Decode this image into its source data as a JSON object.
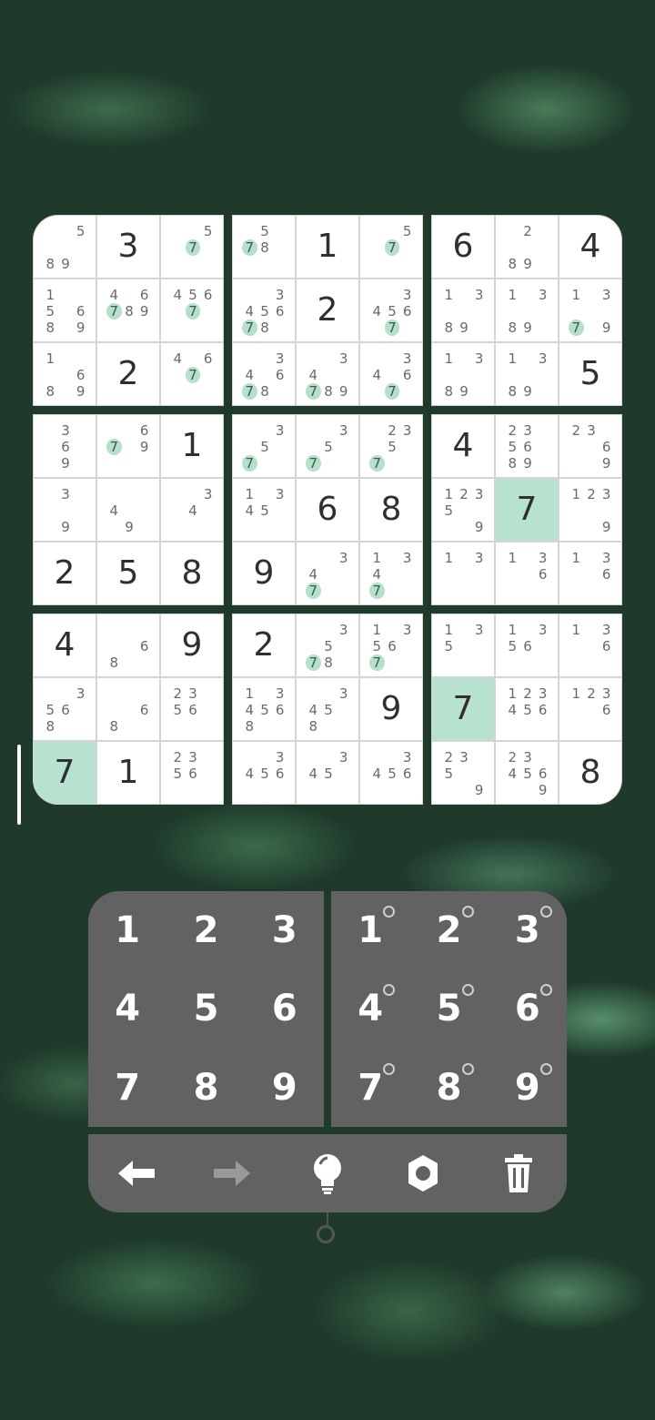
{
  "board": {
    "blocks": [
      [
        {
          "notes": [
            "",
            "",
            "5",
            "",
            "",
            "",
            "8",
            "9",
            ""
          ]
        },
        {
          "value": "3"
        },
        {
          "notes": [
            "",
            "",
            "5",
            "",
            "7",
            "",
            "",
            "",
            ""
          ],
          "hl": "7"
        },
        {
          "notes": [
            "1",
            "",
            "",
            "5",
            "",
            "6",
            "8",
            "",
            "9"
          ]
        },
        {
          "notes": [
            "4",
            "",
            "6",
            "7",
            "8",
            "9",
            "",
            "",
            ""
          ],
          "hl": "7"
        },
        {
          "notes": [
            "4",
            "5",
            "6",
            "",
            "7",
            "",
            "",
            "",
            ""
          ],
          "hl": "7"
        },
        {
          "notes": [
            "1",
            "",
            "",
            "",
            "",
            "6",
            "8",
            "",
            "9"
          ]
        },
        {
          "value": "2"
        },
        {
          "notes": [
            "4",
            "",
            "6",
            "",
            "7",
            "",
            "",
            "",
            ""
          ],
          "hl": "7"
        }
      ],
      [
        {
          "notes": [
            "",
            "5",
            "",
            "7",
            "8",
            "",
            "",
            "",
            ""
          ],
          "hl": "7"
        },
        {
          "value": "1"
        },
        {
          "notes": [
            "",
            "",
            "5",
            "",
            "7",
            "",
            "",
            "",
            ""
          ],
          "hl": "7"
        },
        {
          "notes": [
            "",
            "",
            "3",
            "4",
            "5",
            "6",
            "7",
            "8",
            ""
          ],
          "hl": "7"
        },
        {
          "value": "2"
        },
        {
          "notes": [
            "",
            "",
            "3",
            "4",
            "5",
            "6",
            "",
            "7",
            ""
          ],
          "hl": "7"
        },
        {
          "notes": [
            "",
            "",
            "3",
            "4",
            "",
            "6",
            "7",
            "8",
            ""
          ],
          "hl": "7"
        },
        {
          "notes": [
            "",
            "",
            "3",
            "4",
            "",
            "",
            "7",
            "8",
            "9"
          ],
          "hl": "7"
        },
        {
          "notes": [
            "",
            "",
            "3",
            "4",
            "",
            "6",
            "",
            "7",
            ""
          ],
          "hl": "7"
        }
      ],
      [
        {
          "value": "6"
        },
        {
          "notes": [
            "",
            "2",
            "",
            "",
            "",
            "",
            "8",
            "9",
            ""
          ]
        },
        {
          "value": "4"
        },
        {
          "notes": [
            "1",
            "",
            "3",
            "",
            "",
            "",
            "8",
            "9",
            ""
          ]
        },
        {
          "notes": [
            "1",
            "",
            "3",
            "",
            "",
            "",
            "8",
            "9",
            ""
          ]
        },
        {
          "notes": [
            "1",
            "",
            "3",
            "",
            "",
            "",
            "7",
            "",
            "9"
          ],
          "hl": "7"
        },
        {
          "notes": [
            "1",
            "",
            "3",
            "",
            "",
            "",
            "8",
            "9",
            ""
          ]
        },
        {
          "notes": [
            "1",
            "",
            "3",
            "",
            "",
            "",
            "8",
            "9",
            ""
          ]
        },
        {
          "value": "5"
        }
      ],
      [
        {
          "notes": [
            "",
            "3",
            "",
            "",
            "6",
            "",
            "",
            "9",
            ""
          ]
        },
        {
          "notes": [
            "",
            "",
            "6",
            "7",
            "",
            "9",
            "",
            "",
            ""
          ],
          "hl": "7"
        },
        {
          "value": "1"
        },
        {
          "notes": [
            "",
            "3",
            "",
            "",
            "",
            "",
            "",
            "9",
            ""
          ]
        },
        {
          "notes": [
            "",
            "",
            "",
            "4",
            "",
            "",
            "",
            "9",
            ""
          ]
        },
        {
          "notes": [
            "",
            "",
            "3",
            "",
            "4",
            "",
            "",
            "",
            ""
          ]
        },
        {
          "value": "2"
        },
        {
          "value": "5"
        },
        {
          "value": "8"
        }
      ],
      [
        {
          "notes": [
            "",
            "",
            "3",
            "",
            "5",
            "",
            "7",
            "",
            ""
          ],
          "hl": "7"
        },
        {
          "notes": [
            "",
            "",
            "3",
            "",
            "5",
            "",
            "7",
            "",
            ""
          ],
          "hl": "7"
        },
        {
          "notes": [
            "",
            "2",
            "3",
            "",
            "5",
            "",
            "7",
            "",
            ""
          ],
          "hl": "7"
        },
        {
          "notes": [
            "1",
            "",
            "3",
            "4",
            "5",
            "",
            "",
            "",
            ""
          ]
        },
        {
          "value": "6"
        },
        {
          "value": "8"
        },
        {
          "value": "9"
        },
        {
          "notes": [
            "",
            "",
            "3",
            "4",
            "",
            "",
            "7",
            "",
            ""
          ],
          "hl": "7"
        },
        {
          "notes": [
            "1",
            "",
            "3",
            "4",
            "",
            "",
            "7",
            "",
            ""
          ],
          "hl": "7"
        }
      ],
      [
        {
          "value": "4"
        },
        {
          "notes": [
            "2",
            "3",
            "",
            "5",
            "6",
            "",
            "8",
            "9",
            ""
          ]
        },
        {
          "notes": [
            "2",
            "3",
            "",
            "",
            "",
            "6",
            "",
            "",
            "9"
          ]
        },
        {
          "notes": [
            "1",
            "2",
            "3",
            "5",
            "",
            "",
            "",
            "",
            "9"
          ]
        },
        {
          "value": "7",
          "sel": true
        },
        {
          "notes": [
            "1",
            "2",
            "3",
            "",
            "",
            "",
            "",
            "",
            "9"
          ]
        },
        {
          "notes": [
            "1",
            "",
            "3",
            "",
            "",
            "",
            "",
            "",
            ""
          ]
        },
        {
          "notes": [
            "1",
            "",
            "3",
            "",
            "",
            "6",
            "",
            "",
            ""
          ]
        },
        {
          "notes": [
            "1",
            "",
            "3",
            "",
            "",
            "6",
            "",
            "",
            ""
          ]
        }
      ],
      [
        {
          "value": "4"
        },
        {
          "notes": [
            "",
            "",
            "",
            "",
            "",
            "6",
            "8",
            "",
            ""
          ]
        },
        {
          "value": "9"
        },
        {
          "notes": [
            "",
            "",
            "3",
            "5",
            "6",
            "",
            "8",
            "",
            ""
          ]
        },
        {
          "notes": [
            "",
            "",
            "",
            "",
            "",
            "6",
            "8",
            "",
            ""
          ]
        },
        {
          "notes": [
            "2",
            "3",
            "",
            "5",
            "6",
            "",
            "",
            "",
            ""
          ]
        },
        {
          "value": "7",
          "sel": true
        },
        {
          "value": "1"
        },
        {
          "notes": [
            "2",
            "3",
            "",
            "5",
            "6",
            "",
            "",
            "",
            ""
          ]
        }
      ],
      [
        {
          "value": "2"
        },
        {
          "notes": [
            "",
            "",
            "3",
            "",
            "5",
            "",
            "7",
            "8",
            ""
          ],
          "hl": "7"
        },
        {
          "notes": [
            "1",
            "",
            "3",
            "5",
            "6",
            "",
            "7",
            "",
            ""
          ],
          "hl": "7"
        },
        {
          "notes": [
            "1",
            "",
            "3",
            "4",
            "5",
            "6",
            "8",
            "",
            ""
          ]
        },
        {
          "notes": [
            "",
            "",
            "3",
            "4",
            "5",
            "",
            "8",
            "",
            ""
          ]
        },
        {
          "value": "9"
        },
        {
          "notes": [
            "",
            "",
            "3",
            "4",
            "5",
            "6",
            "",
            "",
            ""
          ]
        },
        {
          "notes": [
            "",
            "",
            "3",
            "4",
            "5",
            "",
            "",
            "",
            ""
          ]
        },
        {
          "notes": [
            "",
            "",
            "3",
            "4",
            "5",
            "6",
            "",
            "",
            ""
          ]
        }
      ],
      [
        {
          "notes": [
            "1",
            "",
            "3",
            "5",
            "",
            "",
            "",
            "",
            ""
          ]
        },
        {
          "notes": [
            "1",
            "",
            "3",
            "5",
            "6",
            "",
            "",
            "",
            ""
          ]
        },
        {
          "notes": [
            "1",
            "",
            "3",
            "",
            "",
            "6",
            "",
            "",
            ""
          ]
        },
        {
          "value": "7",
          "sel": true
        },
        {
          "notes": [
            "1",
            "2",
            "3",
            "4",
            "5",
            "6",
            "",
            "",
            ""
          ]
        },
        {
          "notes": [
            "1",
            "2",
            "3",
            "",
            "",
            "6",
            "",
            "",
            ""
          ]
        },
        {
          "notes": [
            "2",
            "3",
            "",
            "5",
            "",
            "",
            "",
            "",
            "9"
          ]
        },
        {
          "notes": [
            "2",
            "3",
            "",
            "4",
            "5",
            "6",
            "",
            "",
            "9"
          ]
        },
        {
          "value": "8"
        }
      ]
    ]
  },
  "keypad": {
    "normal": [
      "1",
      "2",
      "3",
      "4",
      "5",
      "6",
      "7",
      "8",
      "9"
    ],
    "pencil": [
      "1",
      "2",
      "3",
      "4",
      "5",
      "6",
      "7",
      "8",
      "9"
    ]
  },
  "toolbar": {
    "icons": [
      "undo-arrow-icon",
      "redo-arrow-icon",
      "hint-bulb-icon",
      "settings-gear-icon",
      "trash-icon"
    ]
  },
  "colors": {
    "selected": "#b6e2cf",
    "highlight": "#b5e0cb",
    "pad": "#626262"
  }
}
